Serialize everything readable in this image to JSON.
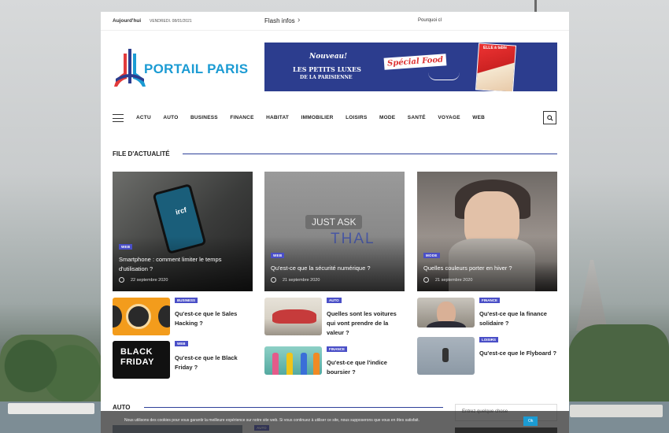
{
  "topbar": {
    "today": "Aujourd'hui",
    "date": "VENDREDI. 08/01/2021",
    "flash": "Flash infos",
    "ticker": "Pourquoi cl"
  },
  "logo": {
    "text": "PORTAIL PARIS"
  },
  "banner": {
    "nouveau": "Nouveau!",
    "line1": "LES PETITS LUXES",
    "line2": "DE LA PARISIENNE",
    "food": "Spécial Food",
    "magazine": "ELLE à table"
  },
  "nav": {
    "items": [
      "ACTU",
      "AUTO",
      "BUSINESS",
      "FINANCE",
      "HABITAT",
      "IMMOBILIER",
      "LOISIRS",
      "MODE",
      "SANTÉ",
      "VOYAGE",
      "WEB"
    ]
  },
  "section": {
    "title": "FILE D'ACTUALITÉ"
  },
  "cards": [
    {
      "badge": "WEB",
      "title": "Smartphone : comment limiter le temps d'utilisation ?",
      "date": "22 septembre 2020",
      "image_text": "ircf"
    },
    {
      "badge": "WEB",
      "title": "Qu'est-ce que la sécurité numérique ?",
      "date": "21 septembre 2020",
      "image_text": "JUST ASK",
      "image_text2": "THAL"
    },
    {
      "badge": "MODE",
      "title": "Quelles couleurs porter en hiver ?",
      "date": "21 septembre 2020"
    }
  ],
  "minis": [
    {
      "badge": "BUSINESS",
      "title": "Qu'est-ce que le Sales Hacking ?"
    },
    {
      "badge": "WEB",
      "title": "Qu'est-ce que le Black Friday ?",
      "image_text": "BLACK FRIDAY"
    },
    {
      "badge": "AUTO",
      "title": "Quelles sont les voitures qui vont prendre de la valeur ?"
    },
    {
      "badge": "FINANCE",
      "title": "Qu'est-ce que l'indice boursier ?"
    },
    {
      "badge": "FINANCE",
      "title": "Qu'est-ce que la finance solidaire ?"
    },
    {
      "badge": "LOISIRS",
      "title": "Qu'est-ce que le Flyboard ?"
    }
  ],
  "auto": {
    "title": "AUTO",
    "badge": "AUTO"
  },
  "search": {
    "placeholder": "Entrez quelque chose"
  },
  "cookie": {
    "text": "Nous utilisons des cookies pour vous garantir la meilleure expérience sur notre site web. Si vous continuez à utiliser ce site, nous supposerons que vous en êtes satisfait.",
    "ok": "Ok"
  }
}
